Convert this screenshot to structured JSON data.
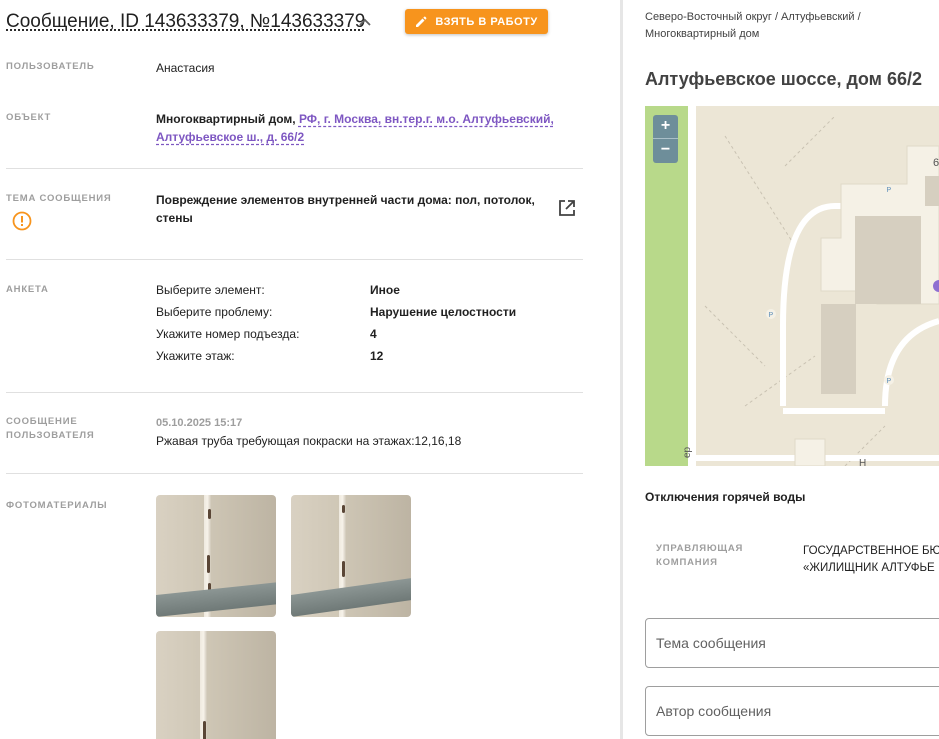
{
  "header": {
    "title": "Сообщение, ID 143633379, №143633379",
    "take_button": "ВЗЯТЬ В РАБОТУ"
  },
  "user": {
    "label": "ПОЛЬЗОВАТЕЛЬ",
    "value": "Анастасия"
  },
  "object": {
    "label": "ОБЪЕКТ",
    "type": "Многоквартирный дом,",
    "address_line1": "РФ, г. Москва, вн.тер.г. м.о. Алтуфьевский,",
    "address_line2": "Алтуфьевское ш., д. 66/2"
  },
  "topic": {
    "label": "ТЕМА СООБЩЕНИЯ",
    "line1": "Повреждение элементов внутренней части дома: пол, потолок,",
    "line2": "стены"
  },
  "survey": {
    "label": "АНКЕТА",
    "rows": [
      {
        "key": "Выберите элемент:",
        "value": "Иное"
      },
      {
        "key": "Выберите проблему:",
        "value": "Нарушение целостности"
      },
      {
        "key": "Укажите номер подъезда:",
        "value": "4"
      },
      {
        "key": "Укажите этаж:",
        "value": "12"
      }
    ]
  },
  "message": {
    "label_line1": "СООБЩЕНИЕ",
    "label_line2": "ПОЛЬЗОВАТЕЛЯ",
    "date": "05.10.2025 15:17",
    "text": "Ржавая труба требующая покраски на этажах:12,16,18"
  },
  "photos": {
    "label": "ФОТОМАТЕРИАЛЫ",
    "count": 3
  },
  "right": {
    "breadcrumb_line1": "Северо-Восточный округ / Алтуфьевский /",
    "breadcrumb_line2": "Многоквартирный дом",
    "address": "Алтуфьевское шоссе, дом 66/2",
    "zoom_in": "+",
    "zoom_out": "−",
    "map_house_number": "6",
    "map_parking": "P",
    "map_road_label_1": "ер",
    "map_road_label_2": "Н",
    "hot_water": "Отключения горячей воды",
    "uk_label_line1": "УПРАВЛЯЮЩАЯ",
    "uk_label_line2": "КОМПАНИЯ",
    "uk_value_line1": "ГОСУДАРСТВЕННОЕ БЮ",
    "uk_value_line2": "«ЖИЛИЩНИК АЛТУФЬЕ",
    "topic_placeholder": "Тема сообщения",
    "author_placeholder": "Автор сообщения"
  },
  "colors": {
    "accent": "#f7941d",
    "link": "#7e57c2",
    "label": "#9e9e9e",
    "map_green": "#b8d98a",
    "map_building": "#d6cfc0"
  }
}
